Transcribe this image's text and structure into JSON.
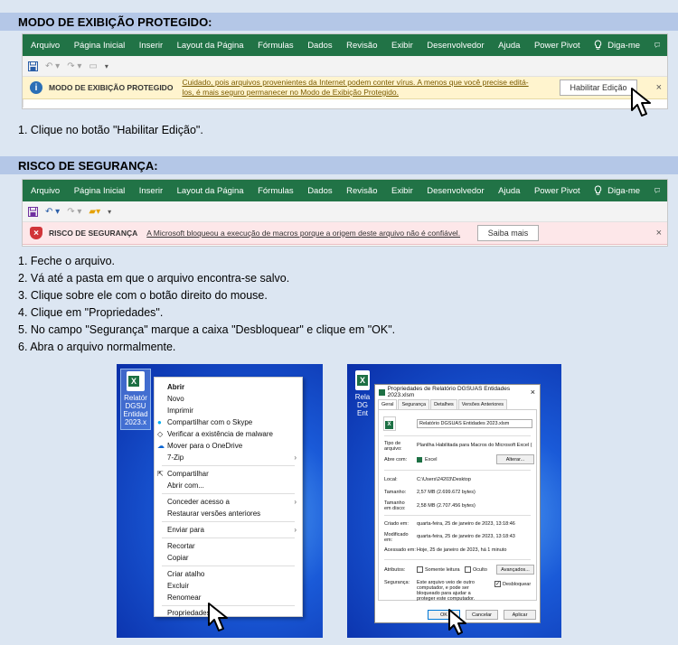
{
  "section1": {
    "title": "MODO DE EXIBIÇÃO PROTEGIDO:",
    "ribbon_tabs": [
      "Arquivo",
      "Página Inicial",
      "Inserir",
      "Layout da Página",
      "Fórmulas",
      "Dados",
      "Revisão",
      "Exibir",
      "Desenvolvedor",
      "Ajuda",
      "Power Pivot"
    ],
    "help_tab": "Diga-me",
    "message_title": "MODO DE EXIBIÇÃO PROTEGIDO",
    "message_text_1": "Cuidado, pois arquivos provenientes da Internet podem conter vírus. A menos que você precise editá-",
    "message_text_2": "los, é mais seguro permanecer no Modo de  Exibição Protegido.",
    "button": "Habilitar Edição",
    "close": "×",
    "instruction": "1. Clique no botão \"Habilitar Edição\"."
  },
  "section2": {
    "title": "RISCO DE SEGURANÇA:",
    "ribbon_tabs": [
      "Arquivo",
      "Página Inicial",
      "Inserir",
      "Layout da Página",
      "Fórmulas",
      "Dados",
      "Revisão",
      "Exibir",
      "Desenvolvedor",
      "Ajuda",
      "Power Pivot"
    ],
    "help_tab": "Diga-me",
    "message_title": "RISCO DE SEGURANÇA",
    "message_text": "A Microsoft bloqueou a execução de macros porque a origem deste arquivo não é confiável.",
    "button": "Saiba mais",
    "close": "×",
    "steps": [
      "1. Feche o arquivo.",
      "2. Vá até a pasta em que o arquivo encontra-se salvo.",
      "3. Clique sobre ele com o botão direito do mouse.",
      "4. Clique em \"Propriedades\".",
      "5. No campo \"Segurança\" marque a caixa \"Desbloquear\" e clique em \"OK\".",
      "6. Abra o arquivo normalmente."
    ]
  },
  "desktop_file": {
    "label_lines": [
      "Relatór",
      "DGSU",
      "Entidad",
      "2023.x"
    ],
    "label_lines_right": [
      "Rela",
      "DG",
      "Ent"
    ]
  },
  "context_menu": {
    "items": [
      "Abrir",
      "Novo",
      "Imprimir",
      "Compartilhar com o Skype",
      "Verificar a existência de malware",
      "Mover para o OneDrive",
      "7-Zip",
      "Compartilhar",
      "Abrir com...",
      "Conceder acesso a",
      "Restaurar versões anteriores",
      "Enviar para",
      "Recortar",
      "Copiar",
      "Criar atalho",
      "Excluir",
      "Renomear",
      "Propriedades"
    ]
  },
  "properties_dialog": {
    "title": "Propriedades de Relatório DGSUAS Entidades 2023.xlsm",
    "tabs": [
      "Geral",
      "Segurança",
      "Detalhes",
      "Versões Anteriores"
    ],
    "filename": "Relatório DGSUAS Entidades 2023.xlsm",
    "type_label": "Tipo de arquivo:",
    "type_value": "Planilha Habilitada para Macros do Microsoft Excel (",
    "opens_label": "Abre com:",
    "opens_value": "Excel",
    "change_button": "Alterar...",
    "location_label": "Local:",
    "location_value": "C:\\Users\\24203\\Desktop",
    "size_label": "Tamanho:",
    "size_value": "2,57 MB (2.699.672 bytes)",
    "disk_label": "Tamanho em disco:",
    "disk_value": "2,58 MB (2.707.456 bytes)",
    "created_label": "Criado em:",
    "created_value": "quarta-feira, 25 de janeiro de 2023, 13:18:46",
    "modified_label": "Modificado em:",
    "modified_value": "quarta-feira, 25 de janeiro de 2023, 13:18:43",
    "accessed_label": "Acessado em:",
    "accessed_value": "Hoje, 25 de janeiro de 2023, há 1 minuto",
    "attributes_label": "Atributos:",
    "readonly": "Somente leitura",
    "hidden": "Oculto",
    "advanced_button": "Avançados...",
    "security_label": "Segurança:",
    "security_text": "Este arquivo veio de outro computador, e pode ser bloqueado para ajudar a proteger este computador.",
    "unblock": "Desbloquear",
    "ok": "OK",
    "cancel": "Cancelar",
    "apply": "Aplicar"
  }
}
